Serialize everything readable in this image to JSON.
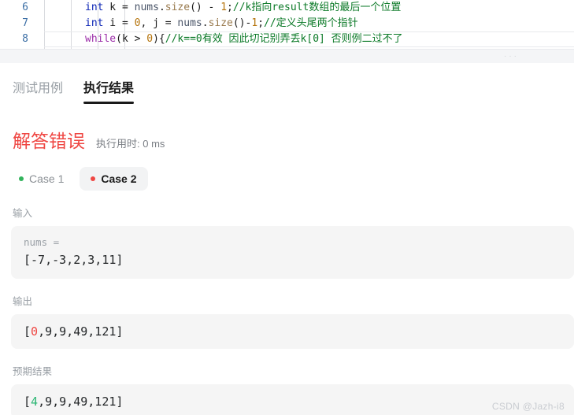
{
  "editor": {
    "lines": [
      {
        "number": "6",
        "tokens": [
          {
            "t": "int",
            "c": "tk-key"
          },
          {
            "t": " k  = ",
            "c": "tk-plain"
          },
          {
            "t": "nums",
            "c": "tk-var"
          },
          {
            "t": ".",
            "c": "tk-punct"
          },
          {
            "t": "size",
            "c": "tk-fn"
          },
          {
            "t": "() - ",
            "c": "tk-punct"
          },
          {
            "t": "1",
            "c": "tk-num"
          },
          {
            "t": ";",
            "c": "tk-punct"
          },
          {
            "t": "//k指向result数组的最后一个位置",
            "c": "tk-cmt"
          }
        ]
      },
      {
        "number": "7",
        "tokens": [
          {
            "t": "int",
            "c": "tk-key"
          },
          {
            "t": " i = ",
            "c": "tk-plain"
          },
          {
            "t": "0",
            "c": "tk-num"
          },
          {
            "t": ", j = ",
            "c": "tk-plain"
          },
          {
            "t": "nums",
            "c": "tk-var"
          },
          {
            "t": ".",
            "c": "tk-punct"
          },
          {
            "t": "size",
            "c": "tk-fn"
          },
          {
            "t": "()-",
            "c": "tk-punct"
          },
          {
            "t": "1",
            "c": "tk-num"
          },
          {
            "t": ";",
            "c": "tk-punct"
          },
          {
            "t": "//定义头尾两个指针",
            "c": "tk-cmt"
          }
        ]
      },
      {
        "number": "8",
        "tokens": [
          {
            "t": "while",
            "c": "tk-kw2"
          },
          {
            "t": "(k > ",
            "c": "tk-punct"
          },
          {
            "t": "0",
            "c": "tk-num"
          },
          {
            "t": "){",
            "c": "tk-punct"
          },
          {
            "t": "//k==0有效 因此切记别弄丢k[0] 否则例二过不了",
            "c": "tk-cmt"
          }
        ]
      }
    ],
    "drag_handle": "···"
  },
  "panel": {
    "tabs": [
      {
        "label": "测试用例",
        "active": false
      },
      {
        "label": "执行结果",
        "active": true
      }
    ],
    "status": {
      "title": "解答错误",
      "runtime": "执行用时: 0 ms",
      "title_color": "#ef4743"
    },
    "cases": [
      {
        "label": "Case 1",
        "state": "pass",
        "selected": false
      },
      {
        "label": "Case 2",
        "state": "fail",
        "selected": true
      }
    ],
    "input": {
      "label": "输入",
      "var_label": "nums =",
      "value": "[-7,-3,2,3,11]"
    },
    "output": {
      "label": "输出",
      "prefix": "[",
      "highlight": "0",
      "rest": ",9,9,49,121]"
    },
    "expected": {
      "label": "预期结果",
      "prefix": "[",
      "highlight": "4",
      "rest": ",9,9,49,121]"
    }
  },
  "watermark": "CSDN @Jazh-i8"
}
